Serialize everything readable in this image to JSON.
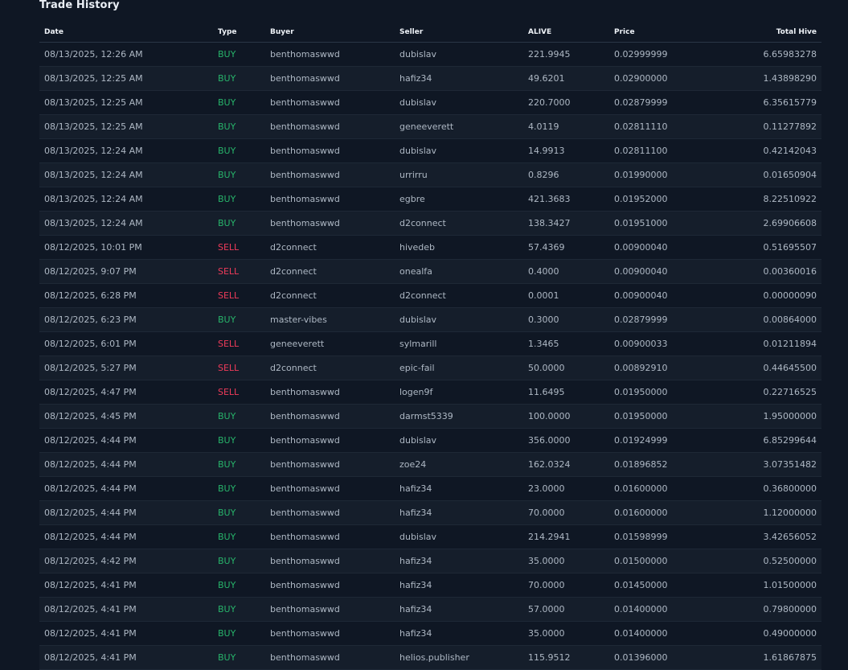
{
  "page": {
    "title": "Trade History"
  },
  "colors": {
    "background": "#0f1724",
    "buy": "#27b36a",
    "sell": "#ef3b5a"
  },
  "table": {
    "headers": [
      "Date",
      "Type",
      "Buyer",
      "Seller",
      "ALIVE",
      "Price",
      "Total Hive"
    ],
    "rows": [
      [
        "08/13/2025, 12:26 AM",
        "BUY",
        "benthomaswwd",
        "dubislav",
        "221.9945",
        "0.02999999",
        "6.65983278"
      ],
      [
        "08/13/2025, 12:25 AM",
        "BUY",
        "benthomaswwd",
        "hafiz34",
        "49.6201",
        "0.02900000",
        "1.43898290"
      ],
      [
        "08/13/2025, 12:25 AM",
        "BUY",
        "benthomaswwd",
        "dubislav",
        "220.7000",
        "0.02879999",
        "6.35615779"
      ],
      [
        "08/13/2025, 12:25 AM",
        "BUY",
        "benthomaswwd",
        "geneeverett",
        "4.0119",
        "0.02811110",
        "0.11277892"
      ],
      [
        "08/13/2025, 12:24 AM",
        "BUY",
        "benthomaswwd",
        "dubislav",
        "14.9913",
        "0.02811100",
        "0.42142043"
      ],
      [
        "08/13/2025, 12:24 AM",
        "BUY",
        "benthomaswwd",
        "urrirru",
        "0.8296",
        "0.01990000",
        "0.01650904"
      ],
      [
        "08/13/2025, 12:24 AM",
        "BUY",
        "benthomaswwd",
        "egbre",
        "421.3683",
        "0.01952000",
        "8.22510922"
      ],
      [
        "08/13/2025, 12:24 AM",
        "BUY",
        "benthomaswwd",
        "d2connect",
        "138.3427",
        "0.01951000",
        "2.69906608"
      ],
      [
        "08/12/2025, 10:01 PM",
        "SELL",
        "d2connect",
        "hivedeb",
        "57.4369",
        "0.00900040",
        "0.51695507"
      ],
      [
        "08/12/2025, 9:07 PM",
        "SELL",
        "d2connect",
        "onealfa",
        "0.4000",
        "0.00900040",
        "0.00360016"
      ],
      [
        "08/12/2025, 6:28 PM",
        "SELL",
        "d2connect",
        "d2connect",
        "0.0001",
        "0.00900040",
        "0.00000090"
      ],
      [
        "08/12/2025, 6:23 PM",
        "BUY",
        "master-vibes",
        "dubislav",
        "0.3000",
        "0.02879999",
        "0.00864000"
      ],
      [
        "08/12/2025, 6:01 PM",
        "SELL",
        "geneeverett",
        "sylmarill",
        "1.3465",
        "0.00900033",
        "0.01211894"
      ],
      [
        "08/12/2025, 5:27 PM",
        "SELL",
        "d2connect",
        "epic-fail",
        "50.0000",
        "0.00892910",
        "0.44645500"
      ],
      [
        "08/12/2025, 4:47 PM",
        "SELL",
        "benthomaswwd",
        "logen9f",
        "11.6495",
        "0.01950000",
        "0.22716525"
      ],
      [
        "08/12/2025, 4:45 PM",
        "BUY",
        "benthomaswwd",
        "darmst5339",
        "100.0000",
        "0.01950000",
        "1.95000000"
      ],
      [
        "08/12/2025, 4:44 PM",
        "BUY",
        "benthomaswwd",
        "dubislav",
        "356.0000",
        "0.01924999",
        "6.85299644"
      ],
      [
        "08/12/2025, 4:44 PM",
        "BUY",
        "benthomaswwd",
        "zoe24",
        "162.0324",
        "0.01896852",
        "3.07351482"
      ],
      [
        "08/12/2025, 4:44 PM",
        "BUY",
        "benthomaswwd",
        "hafiz34",
        "23.0000",
        "0.01600000",
        "0.36800000"
      ],
      [
        "08/12/2025, 4:44 PM",
        "BUY",
        "benthomaswwd",
        "hafiz34",
        "70.0000",
        "0.01600000",
        "1.12000000"
      ],
      [
        "08/12/2025, 4:44 PM",
        "BUY",
        "benthomaswwd",
        "dubislav",
        "214.2941",
        "0.01598999",
        "3.42656052"
      ],
      [
        "08/12/2025, 4:42 PM",
        "BUY",
        "benthomaswwd",
        "hafiz34",
        "35.0000",
        "0.01500000",
        "0.52500000"
      ],
      [
        "08/12/2025, 4:41 PM",
        "BUY",
        "benthomaswwd",
        "hafiz34",
        "70.0000",
        "0.01450000",
        "1.01500000"
      ],
      [
        "08/12/2025, 4:41 PM",
        "BUY",
        "benthomaswwd",
        "hafiz34",
        "57.0000",
        "0.01400000",
        "0.79800000"
      ],
      [
        "08/12/2025, 4:41 PM",
        "BUY",
        "benthomaswwd",
        "hafiz34",
        "35.0000",
        "0.01400000",
        "0.49000000"
      ],
      [
        "08/12/2025, 4:41 PM",
        "BUY",
        "benthomaswwd",
        "helios.publisher",
        "115.9512",
        "0.01396000",
        "1.61867875"
      ]
    ]
  }
}
